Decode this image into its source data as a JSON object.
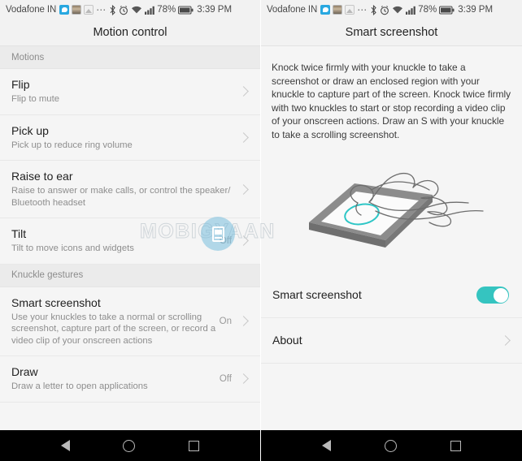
{
  "status_bar": {
    "carrier": "Vodafone IN",
    "icons": [
      "message-icon",
      "app-icon",
      "photo-icon",
      "more-dots-icon",
      "bluetooth-icon",
      "alarm-icon",
      "wifi-icon",
      "signal-icon"
    ],
    "battery_percent": "78%",
    "time": "3:39 PM"
  },
  "left_screen": {
    "title": "Motion control",
    "sections": [
      {
        "header": "Motions",
        "items": [
          {
            "title": "Flip",
            "subtitle": "Flip to mute",
            "value": ""
          },
          {
            "title": "Pick up",
            "subtitle": "Pick up to reduce ring volume",
            "value": ""
          },
          {
            "title": "Raise to ear",
            "subtitle": "Raise to answer or make calls, or control the speaker/ Bluetooth headset",
            "value": ""
          },
          {
            "title": "Tilt",
            "subtitle": "Tilt to move icons and widgets",
            "value": "Off"
          }
        ]
      },
      {
        "header": "Knuckle gestures",
        "items": [
          {
            "title": "Smart screenshot",
            "subtitle": "Use your knuckles to take a normal or scrolling screenshot, capture part of the screen, or record a video clip of your onscreen actions",
            "value": "On"
          },
          {
            "title": "Draw",
            "subtitle": "Draw a letter to open applications",
            "value": "Off"
          }
        ]
      }
    ]
  },
  "right_screen": {
    "title": "Smart screenshot",
    "description": "Knock twice firmly with your knuckle to take a screenshot or draw an enclosed region with your knuckle to capture part of the screen. Knock twice firmly with two knuckles to start or stop recording a video clip of your onscreen actions. Draw an S with your knuckle to take a scrolling screenshot.",
    "illustration": "hand-knuckle-tapping-phone-illustration",
    "rows": [
      {
        "title": "Smart screenshot",
        "control": "toggle",
        "state": "on"
      },
      {
        "title": "About",
        "control": "chevron",
        "state": ""
      }
    ]
  },
  "watermark": {
    "text": "MOBIGYAAN"
  },
  "nav_bar": {
    "items": [
      "back-button",
      "home-button",
      "recents-button"
    ]
  },
  "colors": {
    "accent_teal": "#35c4c0",
    "screen_bg": "#f5f5f5",
    "header_bg": "#f2f2f2",
    "section_bg": "#ebebeb",
    "nav_bg": "#000000"
  }
}
